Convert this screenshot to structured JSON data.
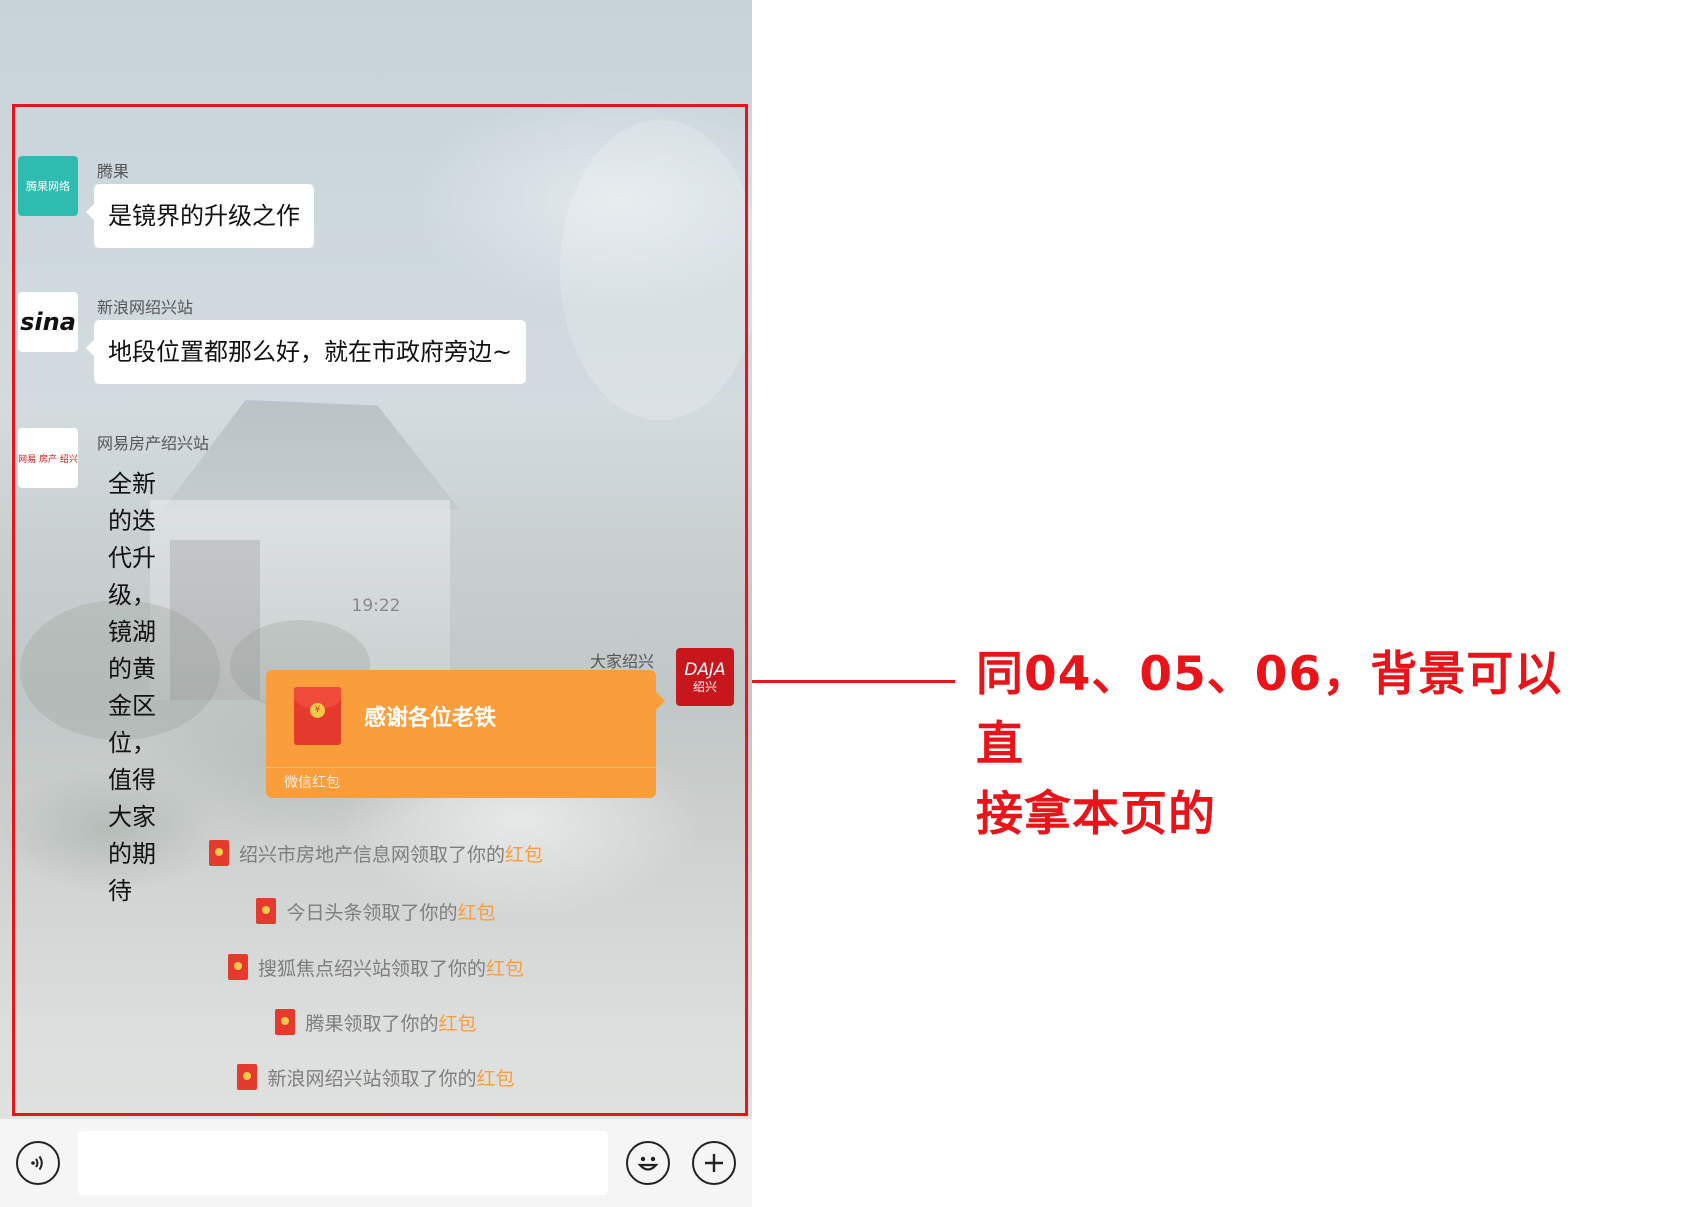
{
  "chat": {
    "messages": [
      {
        "sender": "腾果",
        "avatar_text": "腾果网络",
        "text": "是镜界的升级之作"
      },
      {
        "sender": "新浪网绍兴站",
        "avatar_text": "sina",
        "text": "地段位置都那么好，就在市政府旁边~"
      },
      {
        "sender": "网易房产绍兴站",
        "avatar_text": "网易 房产 绍兴",
        "lines": [
          "全新的迭代升级，镜湖的黄金区位，",
          "值得大家的期待"
        ]
      }
    ],
    "timestamp": "19:22",
    "red_packet": {
      "sender": "大家绍兴",
      "avatar_line1": "DAJA",
      "avatar_line2": "绍兴",
      "title": "感谢各位老铁",
      "footer": "微信红包",
      "coin": "¥"
    },
    "notices": [
      {
        "prefix": "绍兴市房地产信息网领取了你的",
        "link": "红包"
      },
      {
        "prefix": "今日头条领取了你的",
        "link": "红包"
      },
      {
        "prefix": "搜狐焦点绍兴站领取了你的",
        "link": "红包"
      },
      {
        "prefix": "腾果领取了你的",
        "link": "红包"
      },
      {
        "prefix": "新浪网绍兴站领取了你的",
        "link": "红包"
      }
    ]
  },
  "input_bar": {
    "voice_icon": "voice-icon",
    "emoji_icon": "emoji-icon",
    "plus_icon": "plus-icon",
    "input_value": ""
  },
  "annotation": {
    "line1": "同04、05、06，背景可以直",
    "line2": "接拿本页的",
    "color": "#e8141a"
  },
  "colors": {
    "highlight_frame": "#e8141a",
    "red_packet": "#fa9d3b",
    "link": "#fa9d3b"
  }
}
